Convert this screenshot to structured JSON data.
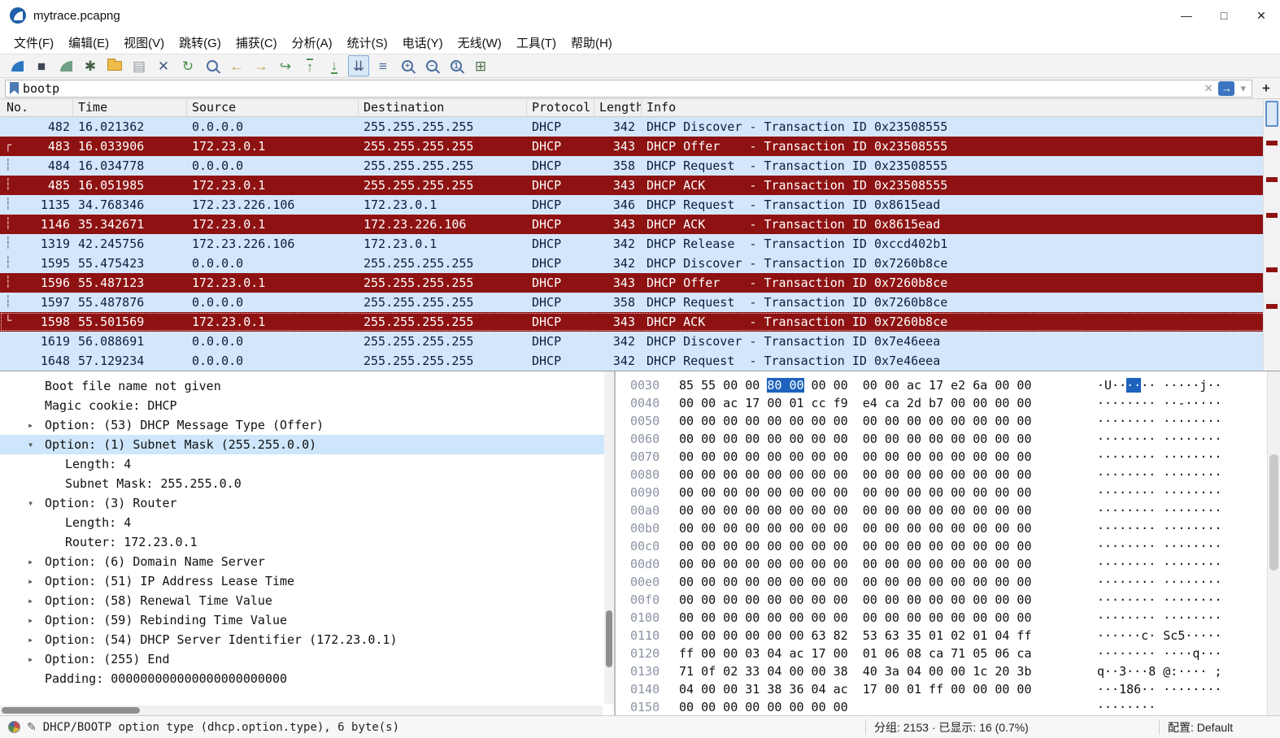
{
  "window": {
    "title": "mytrace.pcapng",
    "minimize": "—",
    "maximize": "□",
    "close": "✕"
  },
  "menu": {
    "items": [
      "文件(F)",
      "编辑(E)",
      "视图(V)",
      "跳转(G)",
      "捕获(C)",
      "分析(A)",
      "统计(S)",
      "电话(Y)",
      "无线(W)",
      "工具(T)",
      "帮助(H)"
    ]
  },
  "toolbar": {
    "icons": [
      {
        "name": "capture-start-icon",
        "kind": "fin",
        "color": "#2b78c0"
      },
      {
        "name": "capture-stop-icon",
        "kind": "glyph",
        "glyph": "■",
        "color": "#3e4654"
      },
      {
        "name": "capture-restart-icon",
        "kind": "fin",
        "color": "#6f9f85"
      },
      {
        "name": "capture-options-icon",
        "kind": "glyph",
        "glyph": "✱",
        "color": "#47634a"
      },
      {
        "name": "open-file-icon",
        "kind": "folder"
      },
      {
        "name": "save-file-icon",
        "kind": "glyph",
        "glyph": "▤",
        "color": "#8e949e"
      },
      {
        "name": "close-file-icon",
        "kind": "glyph",
        "glyph": "✕",
        "color": "#44597e"
      },
      {
        "name": "reload-icon",
        "kind": "glyph",
        "glyph": "↻",
        "color": "#4b8f4b"
      },
      {
        "name": "find-packet-icon",
        "kind": "mag",
        "sign": ""
      },
      {
        "name": "go-back-icon",
        "kind": "glyph",
        "glyph": "←",
        "color": "#b99a3e"
      },
      {
        "name": "go-forward-icon",
        "kind": "glyph",
        "glyph": "→",
        "color": "#b99a3e"
      },
      {
        "name": "go-to-packet-icon",
        "kind": "glyph",
        "glyph": "↪",
        "color": "#4b8f4b"
      },
      {
        "name": "go-first-packet-icon",
        "kind": "glyph",
        "glyph": "↑",
        "color": "#4b8f4b",
        "line": "top"
      },
      {
        "name": "go-last-packet-icon",
        "kind": "glyph",
        "glyph": "↓",
        "color": "#4b8f4b",
        "line": "bottom"
      },
      {
        "name": "auto-scroll-icon",
        "kind": "glyph",
        "glyph": "⇊",
        "color": "#44597e",
        "pressed": true
      },
      {
        "name": "colorize-icon",
        "kind": "glyph",
        "glyph": "≡",
        "color": "#4b6f9e"
      },
      {
        "name": "zoom-in-icon",
        "kind": "mag",
        "sign": "+"
      },
      {
        "name": "zoom-out-icon",
        "kind": "mag",
        "sign": "−"
      },
      {
        "name": "zoom-original-icon",
        "kind": "mag",
        "sign": "1"
      },
      {
        "name": "resize-columns-icon",
        "kind": "glyph",
        "glyph": "⊞",
        "color": "#4b6f4b"
      }
    ]
  },
  "filter": {
    "value": "bootp",
    "clear": "✕",
    "apply": "→",
    "dropdown": "▾",
    "add": "+"
  },
  "packet_list": {
    "columns": [
      {
        "key": "no",
        "label": "No."
      },
      {
        "key": "time",
        "label": "Time"
      },
      {
        "key": "source",
        "label": "Source"
      },
      {
        "key": "destination",
        "label": "Destination"
      },
      {
        "key": "protocol",
        "label": "Protocol"
      },
      {
        "key": "length",
        "label": "Length"
      },
      {
        "key": "info",
        "label": "Info"
      }
    ],
    "rows": [
      {
        "no": "482",
        "time": "16.021362",
        "source": "0.0.0.0",
        "destination": "255.255.255.255",
        "protocol": "DHCP",
        "length": "342",
        "info": "DHCP Discover - Transaction ID 0x23508555",
        "color": "blue",
        "mark": "",
        "focus": false
      },
      {
        "no": "483",
        "time": "16.033906",
        "source": "172.23.0.1",
        "destination": "255.255.255.255",
        "protocol": "DHCP",
        "length": "343",
        "info": "DHCP Offer    - Transaction ID 0x23508555",
        "color": "red",
        "mark": "start",
        "focus": false
      },
      {
        "no": "484",
        "time": "16.034778",
        "source": "0.0.0.0",
        "destination": "255.255.255.255",
        "protocol": "DHCP",
        "length": "358",
        "info": "DHCP Request  - Transaction ID 0x23508555",
        "color": "blue",
        "mark": "dash",
        "focus": false
      },
      {
        "no": "485",
        "time": "16.051985",
        "source": "172.23.0.1",
        "destination": "255.255.255.255",
        "protocol": "DHCP",
        "length": "343",
        "info": "DHCP ACK      - Transaction ID 0x23508555",
        "color": "red",
        "mark": "dash",
        "focus": false
      },
      {
        "no": "1135",
        "time": "34.768346",
        "source": "172.23.226.106",
        "destination": "172.23.0.1",
        "protocol": "DHCP",
        "length": "346",
        "info": "DHCP Request  - Transaction ID 0x8615ead",
        "color": "blue",
        "mark": "dash",
        "focus": false
      },
      {
        "no": "1146",
        "time": "35.342671",
        "source": "172.23.0.1",
        "destination": "172.23.226.106",
        "protocol": "DHCP",
        "length": "343",
        "info": "DHCP ACK      - Transaction ID 0x8615ead",
        "color": "red",
        "mark": "dash",
        "focus": false
      },
      {
        "no": "1319",
        "time": "42.245756",
        "source": "172.23.226.106",
        "destination": "172.23.0.1",
        "protocol": "DHCP",
        "length": "342",
        "info": "DHCP Release  - Transaction ID 0xccd402b1",
        "color": "blue",
        "mark": "dash",
        "focus": false
      },
      {
        "no": "1595",
        "time": "55.475423",
        "source": "0.0.0.0",
        "destination": "255.255.255.255",
        "protocol": "DHCP",
        "length": "342",
        "info": "DHCP Discover - Transaction ID 0x7260b8ce",
        "color": "blue",
        "mark": "dash",
        "focus": false
      },
      {
        "no": "1596",
        "time": "55.487123",
        "source": "172.23.0.1",
        "destination": "255.255.255.255",
        "protocol": "DHCP",
        "length": "343",
        "info": "DHCP Offer    - Transaction ID 0x7260b8ce",
        "color": "red",
        "mark": "dash",
        "focus": false
      },
      {
        "no": "1597",
        "time": "55.487876",
        "source": "0.0.0.0",
        "destination": "255.255.255.255",
        "protocol": "DHCP",
        "length": "358",
        "info": "DHCP Request  - Transaction ID 0x7260b8ce",
        "color": "blue",
        "mark": "dash",
        "focus": false
      },
      {
        "no": "1598",
        "time": "55.501569",
        "source": "172.23.0.1",
        "destination": "255.255.255.255",
        "protocol": "DHCP",
        "length": "343",
        "info": "DHCP ACK      - Transaction ID 0x7260b8ce",
        "color": "red",
        "mark": "end",
        "focus": true
      },
      {
        "no": "1619",
        "time": "56.088691",
        "source": "0.0.0.0",
        "destination": "255.255.255.255",
        "protocol": "DHCP",
        "length": "342",
        "info": "DHCP Discover - Transaction ID 0x7e46eea",
        "color": "blue",
        "mark": "",
        "focus": false
      },
      {
        "no": "1648",
        "time": "57.129234",
        "source": "0.0.0.0",
        "destination": "255.255.255.255",
        "protocol": "DHCP",
        "length": "342",
        "info": "DHCP Request  - Transaction ID 0x7e46eea",
        "color": "blue",
        "mark": "",
        "focus": false
      }
    ]
  },
  "details": {
    "items": [
      {
        "indent": 1,
        "arrow": "",
        "text": "Boot file name not given",
        "selected": false
      },
      {
        "indent": 1,
        "arrow": "",
        "text": "Magic cookie: DHCP",
        "selected": false
      },
      {
        "indent": 1,
        "arrow": "collapsed",
        "text": "Option: (53) DHCP Message Type (Offer)",
        "selected": false
      },
      {
        "indent": 1,
        "arrow": "expanded",
        "text": "Option: (1) Subnet Mask (255.255.0.0)",
        "selected": true
      },
      {
        "indent": 2,
        "arrow": "",
        "text": "Length: 4",
        "selected": false
      },
      {
        "indent": 2,
        "arrow": "",
        "text": "Subnet Mask: 255.255.0.0",
        "selected": false
      },
      {
        "indent": 1,
        "arrow": "expanded",
        "text": "Option: (3) Router",
        "selected": false
      },
      {
        "indent": 2,
        "arrow": "",
        "text": "Length: 4",
        "selected": false
      },
      {
        "indent": 2,
        "arrow": "",
        "text": "Router: 172.23.0.1",
        "selected": false
      },
      {
        "indent": 1,
        "arrow": "collapsed",
        "text": "Option: (6) Domain Name Server",
        "selected": false
      },
      {
        "indent": 1,
        "arrow": "collapsed",
        "text": "Option: (51) IP Address Lease Time",
        "selected": false
      },
      {
        "indent": 1,
        "arrow": "collapsed",
        "text": "Option: (58) Renewal Time Value",
        "selected": false
      },
      {
        "indent": 1,
        "arrow": "collapsed",
        "text": "Option: (59) Rebinding Time Value",
        "selected": false
      },
      {
        "indent": 1,
        "arrow": "collapsed",
        "text": "Option: (54) DHCP Server Identifier (172.23.0.1)",
        "selected": false
      },
      {
        "indent": 1,
        "arrow": "collapsed",
        "text": "Option: (255) End",
        "selected": false
      },
      {
        "indent": 1,
        "arrow": "",
        "text": "Padding: 000000000000000000000000",
        "selected": false
      }
    ]
  },
  "hex": {
    "rows": [
      {
        "offset": "0030",
        "h1": "85 55 00 00 ",
        "hs": "80 00",
        "h2": " 00 00  00 00 ac 17 e2 6a 00 00",
        "a1": "·U··",
        "as": "··",
        "a2": "·· ·····j··"
      },
      {
        "offset": "0040",
        "h1": "00 00 ac 17 00 01 cc f9  e4 ca 2d b7 00 00 00 00",
        "hs": "",
        "h2": "",
        "a1": "········ ··-·····",
        "as": "",
        "a2": ""
      },
      {
        "offset": "0050",
        "h1": "00 00 00 00 00 00 00 00  00 00 00 00 00 00 00 00",
        "hs": "",
        "h2": "",
        "a1": "········ ········",
        "as": "",
        "a2": ""
      },
      {
        "offset": "0060",
        "h1": "00 00 00 00 00 00 00 00  00 00 00 00 00 00 00 00",
        "hs": "",
        "h2": "",
        "a1": "········ ········",
        "as": "",
        "a2": ""
      },
      {
        "offset": "0070",
        "h1": "00 00 00 00 00 00 00 00  00 00 00 00 00 00 00 00",
        "hs": "",
        "h2": "",
        "a1": "········ ········",
        "as": "",
        "a2": ""
      },
      {
        "offset": "0080",
        "h1": "00 00 00 00 00 00 00 00  00 00 00 00 00 00 00 00",
        "hs": "",
        "h2": "",
        "a1": "········ ········",
        "as": "",
        "a2": ""
      },
      {
        "offset": "0090",
        "h1": "00 00 00 00 00 00 00 00  00 00 00 00 00 00 00 00",
        "hs": "",
        "h2": "",
        "a1": "········ ········",
        "as": "",
        "a2": ""
      },
      {
        "offset": "00a0",
        "h1": "00 00 00 00 00 00 00 00  00 00 00 00 00 00 00 00",
        "hs": "",
        "h2": "",
        "a1": "········ ········",
        "as": "",
        "a2": ""
      },
      {
        "offset": "00b0",
        "h1": "00 00 00 00 00 00 00 00  00 00 00 00 00 00 00 00",
        "hs": "",
        "h2": "",
        "a1": "········ ········",
        "as": "",
        "a2": ""
      },
      {
        "offset": "00c0",
        "h1": "00 00 00 00 00 00 00 00  00 00 00 00 00 00 00 00",
        "hs": "",
        "h2": "",
        "a1": "········ ········",
        "as": "",
        "a2": ""
      },
      {
        "offset": "00d0",
        "h1": "00 00 00 00 00 00 00 00  00 00 00 00 00 00 00 00",
        "hs": "",
        "h2": "",
        "a1": "········ ········",
        "as": "",
        "a2": ""
      },
      {
        "offset": "00e0",
        "h1": "00 00 00 00 00 00 00 00  00 00 00 00 00 00 00 00",
        "hs": "",
        "h2": "",
        "a1": "········ ········",
        "as": "",
        "a2": ""
      },
      {
        "offset": "00f0",
        "h1": "00 00 00 00 00 00 00 00  00 00 00 00 00 00 00 00",
        "hs": "",
        "h2": "",
        "a1": "········ ········",
        "as": "",
        "a2": ""
      },
      {
        "offset": "0100",
        "h1": "00 00 00 00 00 00 00 00  00 00 00 00 00 00 00 00",
        "hs": "",
        "h2": "",
        "a1": "········ ········",
        "as": "",
        "a2": ""
      },
      {
        "offset": "0110",
        "h1": "00 00 00 00 00 00 63 82  53 63 35 01 02 01 04 ff",
        "hs": "",
        "h2": "",
        "a1": "······c· Sc5·····",
        "as": "",
        "a2": ""
      },
      {
        "offset": "0120",
        "h1": "ff 00 00 03 04 ac 17 00  01 06 08 ca 71 05 06 ca",
        "hs": "",
        "h2": "",
        "a1": "········ ····q···",
        "as": "",
        "a2": ""
      },
      {
        "offset": "0130",
        "h1": "71 0f 02 33 04 00 00 38  40 3a 04 00 00 1c 20 3b",
        "hs": "",
        "h2": "",
        "a1": "q··3···8 @:···· ;",
        "as": "",
        "a2": ""
      },
      {
        "offset": "0140",
        "h1": "04 00 00 31 38 36 04 ac  17 00 01 ff 00 00 00 00",
        "hs": "",
        "h2": "",
        "a1": "···186·· ········",
        "as": "",
        "a2": ""
      },
      {
        "offset": "0150",
        "h1": "00 00 00 00 00 00 00 00",
        "hs": "",
        "h2": "",
        "a1": "········",
        "as": "",
        "a2": ""
      }
    ]
  },
  "statusbar": {
    "field_info": "DHCP/BOOTP option type (dhcp.option.type), 6 byte(s)",
    "packets_info": "分组: 2153 · 已显示: 16 (0.7%)",
    "profile": "配置: Default"
  }
}
